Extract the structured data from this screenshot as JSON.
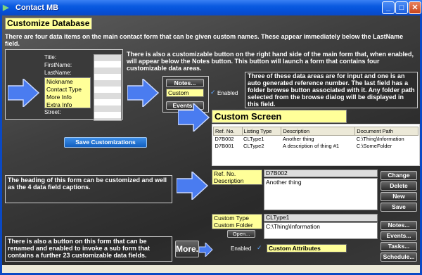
{
  "window": {
    "title": "Contact MB",
    "minimize": "_",
    "maximize": "□",
    "close": "✕"
  },
  "heading": "Customize Database",
  "intro": "There are four data items on the main contact form that can be given custom names. These appear immediately below the LastName field.",
  "form_fields": [
    "Title:",
    "FirstName:",
    "LastName:"
  ],
  "custom_names": [
    "Nickname",
    "Contact Type",
    "More Info",
    "Extra Info"
  ],
  "street_label": "Street:",
  "notes_desc": "There is also a customizable button on the right hand side of the main form that, when enabled, will appear below the Notes button. This button will launch a form that contains four customizable data areas.",
  "mini_buttons": {
    "notes": "Notes...",
    "custom": "Custom",
    "events": "Events..."
  },
  "enabled_label": "Enabled",
  "areas_desc": "Three of these data areas are for input and one is an auto generated reference number. The last field has a folder browse button associated with it. Any folder path selected from the browse dialog will be displayed in this field.",
  "save_button": "Save Customizations",
  "custom_screen": {
    "title": "Custom Screen",
    "columns": [
      "Ref. No.",
      "Listing Type",
      "Description",
      "Document Path"
    ],
    "rows": [
      [
        "D7B002",
        "CLType1",
        "Another thing",
        "C:\\Thing\\Information"
      ],
      [
        "D7B001",
        "CLType2",
        "A description of thing #1",
        "C:\\SomeFolder"
      ]
    ],
    "field_labels": {
      "ref": "Ref. No.",
      "desc": "Description",
      "type": "Custom Type",
      "folder": "Custom Folder"
    },
    "values": {
      "ref": "D7B002",
      "desc": "Another thing",
      "type": "CLType1",
      "folder": "C:\\Thing\\Information"
    },
    "open_button": "Open...",
    "right_buttons": [
      "Change",
      "Delete",
      "New",
      "Save"
    ],
    "lower_buttons": [
      "Notes...",
      "Events...",
      "Tasks...",
      "Schedule..."
    ],
    "enabled_label": "Enabled",
    "attributes_value": "Custom Attributes"
  },
  "heading_desc": "The heading of this form can be customized and well as the 4 data field captions.",
  "more_desc": "There is also a button on this form that can be renamed and enabled to invoke a sub form that contains a further 23 customizable data fields.",
  "more_button": "More...",
  "colors": {
    "highlight": "#ffff99",
    "arrow": "#4a7cf0",
    "title_bar": "#0a5ae0"
  }
}
